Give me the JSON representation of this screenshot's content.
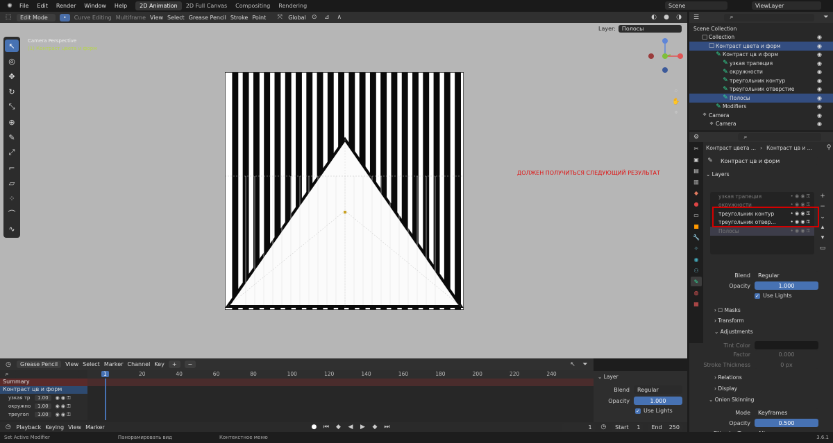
{
  "menu": {
    "file": "File",
    "edit": "Edit",
    "render": "Render",
    "window": "Window",
    "help": "Help"
  },
  "workspaces": [
    "2D Animation",
    "2D Full Canvas",
    "Compositing",
    "Rendering"
  ],
  "scene": {
    "scene_label": "Scene",
    "viewlayer_label": "ViewLayer"
  },
  "viewport_header": {
    "mode": "Edit Mode",
    "curve_editing": "Curve Editing",
    "multiframe": "Multiframe",
    "view": "View",
    "select": "Select",
    "grease_pencil": "Grease Pencil",
    "stroke": "Stroke",
    "point": "Point",
    "orientation": "Global",
    "layer_label": "Layer:",
    "layer_value": "Полосы"
  },
  "viewport": {
    "camera_title": "Camera Perspective",
    "camera_sub": "(1) Контраст цвета и форм",
    "annotation": "ДОЛЖЕН ПОЛУЧИТЬСЯ СЛЕДУЮЩИЙ РЕЗУЛЬТАТ",
    "stripe_count": 22
  },
  "outliner": {
    "root": "Scene Collection",
    "items": [
      {
        "label": "Collection",
        "indent": 1
      },
      {
        "label": "Контраст цвета и форм",
        "indent": 2,
        "sel": true
      },
      {
        "label": "Контраст цв и форм",
        "indent": 3
      },
      {
        "label": "узкая трапеция",
        "indent": 4
      },
      {
        "label": "окружности",
        "indent": 4
      },
      {
        "label": "треугольник контур",
        "indent": 4
      },
      {
        "label": "треугольник отверстие",
        "indent": 4
      },
      {
        "label": "Полосы",
        "indent": 4,
        "sel": true
      },
      {
        "label": "Modifiers",
        "indent": 3
      },
      {
        "label": "Camera",
        "indent": 1
      },
      {
        "label": "Camera",
        "indent": 2
      }
    ]
  },
  "properties": {
    "breadcrumb_1": "Контраст цвета ...",
    "breadcrumb_2": "Контраст цв и ...",
    "data_name": "Контраст цв и форм",
    "layers_header": "Layers",
    "layers": [
      {
        "label": "узкая трапеция",
        "dim": true
      },
      {
        "label": "окружности",
        "dim": true
      },
      {
        "label": "треугольник контур",
        "dim": false
      },
      {
        "label": "треугольник отвер...",
        "dim": false
      },
      {
        "label": "Полосы",
        "dim": true,
        "sel": true
      }
    ],
    "blend_label": "Blend",
    "blend_value": "Regular",
    "opacity_label": "Opacity",
    "opacity_value": "1.000",
    "use_lights": "Use Lights",
    "masks": "Masks",
    "transform": "Transform",
    "adjustments": "Adjustments",
    "tint_color": "Tint Color",
    "factor": "Factor",
    "factor_value": "0.000",
    "stroke_thickness": "Stroke Thickness",
    "stroke_thickness_value": "0 px",
    "relations": "Relations",
    "display": "Display",
    "onion": "Onion Skinning",
    "mode_label": "Mode",
    "mode_value": "Keyframes",
    "onion_opacity_label": "Opacity",
    "onion_opacity_value": "0.500",
    "filter_label": "Filter by Type",
    "filter_value": "All"
  },
  "timeline": {
    "editor": "Grease Pencil",
    "view": "View",
    "select": "Select",
    "marker": "Marker",
    "channel": "Channel",
    "key": "Key",
    "frames": [
      "1",
      "20",
      "40",
      "60",
      "80",
      "100",
      "120",
      "140",
      "160",
      "180",
      "200",
      "220",
      "240"
    ],
    "summary": "Summary",
    "object": "Контраст цв и форм",
    "channels": [
      {
        "label": "узкая тр",
        "value": "1.00"
      },
      {
        "label": "окружно",
        "value": "1.00"
      },
      {
        "label": "треугол",
        "value": "1.00"
      }
    ]
  },
  "side_panel": {
    "title": "Layer",
    "blend_label": "Blend",
    "blend_value": "Regular",
    "opacity_label": "Opacity",
    "opacity_value": "1.000",
    "use_lights": "Use Lights"
  },
  "playback": {
    "playback": "Playback",
    "keying": "Keying",
    "view": "View",
    "marker": "Marker",
    "current": "1",
    "start_label": "Start",
    "start": "1",
    "end_label": "End",
    "end": "250"
  },
  "status": {
    "left": "Set Active Modifier",
    "middle": "Панорамировать вид",
    "right": "Контекстное меню",
    "version": "3.6.1"
  },
  "colors": {
    "accent": "#4772b3",
    "annotation": "#e01010",
    "highlight_box": "#d40000"
  }
}
